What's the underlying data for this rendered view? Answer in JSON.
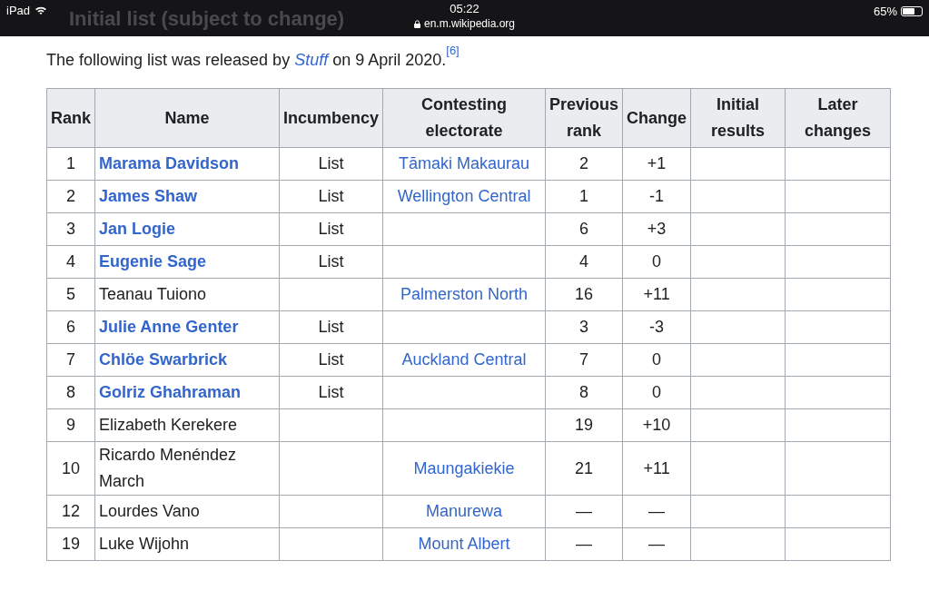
{
  "status_bar": {
    "device": "iPad",
    "time": "05:22",
    "url": "en.m.wikipedia.org",
    "battery": "65%"
  },
  "section_heading": "Initial list (subject to change)",
  "intro": {
    "before": "The following list was released by ",
    "link": "Stuff",
    "after": " on 9 April 2020.",
    "ref": "[6]"
  },
  "table": {
    "columns": [
      "Rank",
      "Name",
      "Incumbency",
      "Contesting electorate",
      "Previous rank",
      "Change",
      "Initial results",
      "Later changes"
    ],
    "rows": [
      {
        "rank": "1",
        "name": "Marama Davidson",
        "linked": true,
        "incumbency": "List",
        "electorate": "Tāmaki Makaurau",
        "previous_rank": "2",
        "change": "+1"
      },
      {
        "rank": "2",
        "name": "James Shaw",
        "linked": true,
        "incumbency": "List",
        "electorate": "Wellington Central",
        "previous_rank": "1",
        "change": "-1"
      },
      {
        "rank": "3",
        "name": "Jan Logie",
        "linked": true,
        "incumbency": "List",
        "previous_rank": "6",
        "change": "+3"
      },
      {
        "rank": "4",
        "name": "Eugenie Sage",
        "linked": true,
        "incumbency": "List",
        "previous_rank": "4",
        "change": "0"
      },
      {
        "rank": "5",
        "name": "Teanau Tuiono",
        "linked": false,
        "electorate": "Palmerston North",
        "previous_rank": "16",
        "change": "+11"
      },
      {
        "rank": "6",
        "name": "Julie Anne Genter",
        "linked": true,
        "incumbency": "List",
        "previous_rank": "3",
        "change": "-3"
      },
      {
        "rank": "7",
        "name": "Chlöe Swarbrick",
        "linked": true,
        "incumbency": "List",
        "electorate": "Auckland Central",
        "previous_rank": "7",
        "change": "0"
      },
      {
        "rank": "8",
        "name": "Golriz Ghahraman",
        "linked": true,
        "incumbency": "List",
        "previous_rank": "8",
        "change": "0"
      },
      {
        "rank": "9",
        "name": "Elizabeth Kerekere",
        "linked": false,
        "previous_rank": "19",
        "change": "+10"
      },
      {
        "rank": "10",
        "name": "Ricardo Menéndez March",
        "linked": false,
        "electorate": "Maungakiekie",
        "previous_rank": "21",
        "change": "+11"
      },
      {
        "rank": "12",
        "name": "Lourdes Vano",
        "linked": false,
        "electorate": "Manurewa",
        "previous_rank": "—",
        "change": "—"
      },
      {
        "rank": "19",
        "name": "Luke Wijohn",
        "linked": false,
        "electorate": "Mount Albert",
        "previous_rank": "—",
        "change": "—"
      }
    ]
  }
}
